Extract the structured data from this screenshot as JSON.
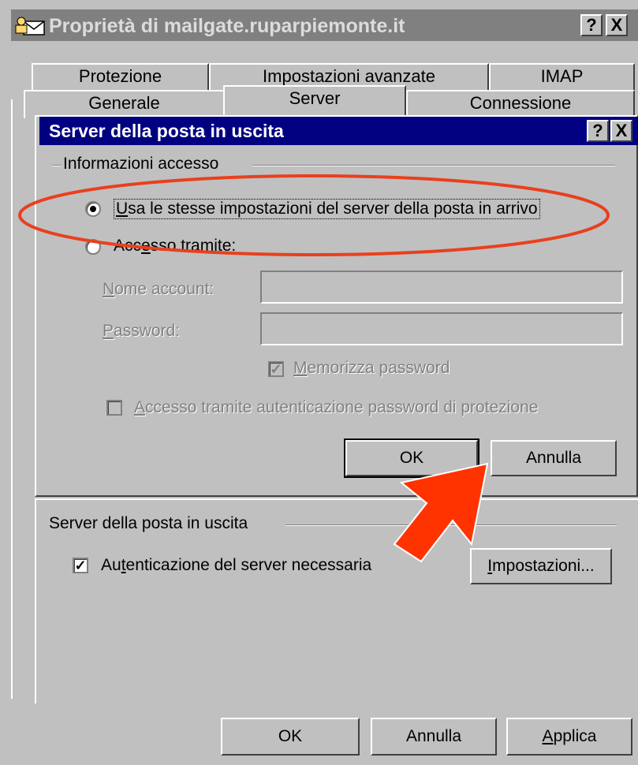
{
  "window": {
    "title": "Proprietà di mailgate.ruparpiemonte.it",
    "help_button": "?",
    "close_button": "X"
  },
  "tabs_row1": [
    "Protezione",
    "Impostazioni avanzate",
    "IMAP"
  ],
  "tabs_row2": [
    "Generale",
    "Server",
    "Connessione"
  ],
  "dialog": {
    "title": "Server della posta in uscita",
    "help_button": "?",
    "close_button": "X",
    "group_title": "Informazioni accesso",
    "radio_same": {
      "accel": "U",
      "rest": "sa le stesse impostazioni del server della posta in arrivo",
      "selected": true
    },
    "radio_logon": {
      "pre": "Acc",
      "accel": "e",
      "post": "sso tramite:",
      "selected": false
    },
    "account_label": {
      "accel": "N",
      "rest": "ome account:"
    },
    "password_label": {
      "accel": "P",
      "rest": "assword:"
    },
    "remember_password": {
      "accel": "M",
      "rest": "emorizza password",
      "checked": true
    },
    "spa": {
      "accel": "A",
      "rest": "ccesso tramite autenticazione password di protezione",
      "checked": false
    },
    "ok": "OK",
    "cancel": "Annulla"
  },
  "server_section": {
    "group_title": "Server della posta in uscita",
    "auth_required": {
      "pre": "Au",
      "accel": "t",
      "post": "enticazione del server necessaria",
      "checked": true
    },
    "settings_button": {
      "accel": "I",
      "rest": "mpostazioni..."
    }
  },
  "footer": {
    "ok": "OK",
    "cancel": "Annulla",
    "apply": {
      "accel": "A",
      "rest": "pplica"
    }
  },
  "annotations": {
    "ellipse_color": "#e8401e",
    "arrow_color": "#ff3300"
  }
}
